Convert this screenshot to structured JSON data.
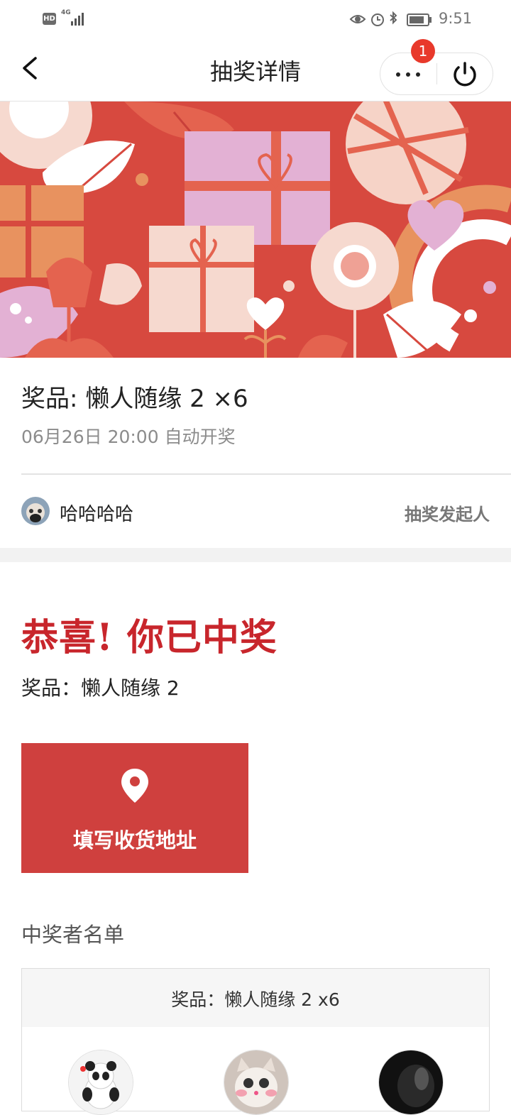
{
  "status_bar": {
    "hd": "HD",
    "network": "4G",
    "time": "9:51",
    "icons": [
      "eye-icon",
      "alarm-icon",
      "bluetooth-icon",
      "battery-icon"
    ]
  },
  "nav": {
    "title": "抽奖详情",
    "badge": "1",
    "icons": [
      "back-icon",
      "more-icon",
      "power-icon"
    ]
  },
  "lottery": {
    "prize_title": "奖品: 懒人随缘 2 ×6",
    "draw_time": "06月26日 20:00 自动开奖"
  },
  "host": {
    "name": "哈哈哈哈",
    "role": "抽奖发起人"
  },
  "result": {
    "headline": "恭喜! 你已中奖",
    "prize": "奖品：懒人随缘 2"
  },
  "address_button": {
    "label": "填写收货地址",
    "icon": "location-pin-icon"
  },
  "winners": {
    "heading": "中奖者名单",
    "box_header": "奖品：懒人随缘 2 x6"
  },
  "colors": {
    "accent": "#cf403e",
    "headline": "#c8262c",
    "badge": "#e8392b",
    "banner_bg": "#d7493f"
  }
}
